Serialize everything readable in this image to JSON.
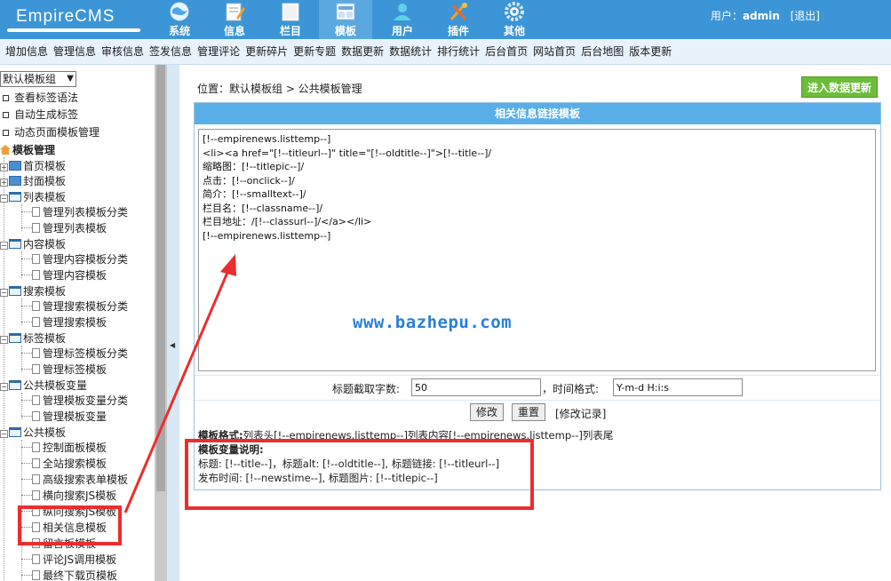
{
  "header": {
    "logo": "EmpireCMS",
    "nav": [
      {
        "label": "系统",
        "icon": "globe-icon"
      },
      {
        "label": "信息",
        "icon": "pencil-note-icon"
      },
      {
        "label": "栏目",
        "icon": "folder-icon"
      },
      {
        "label": "模板",
        "icon": "template-icon"
      },
      {
        "label": "用户",
        "icon": "user-icon"
      },
      {
        "label": "插件",
        "icon": "tools-icon"
      },
      {
        "label": "其他",
        "icon": "gear-icon"
      }
    ],
    "active_nav": "模板",
    "user_prefix": "用户：",
    "user_name": "admin",
    "logout": "[退出]"
  },
  "menubar": [
    "增加信息",
    "管理信息",
    "审核信息",
    "签发信息",
    "管理评论",
    "更新碎片",
    "更新专题",
    "数据更新",
    "数据统计",
    "排行统计",
    "后台首页",
    "网站首页",
    "后台地图",
    "版本更新"
  ],
  "sidebar": {
    "group_select": "默认模板组",
    "top_links": [
      "查看标签语法",
      "自动生成标签",
      "动态页面模板管理"
    ],
    "root": "模板管理",
    "items": {
      "home_tpl": "首页模板",
      "cover_tpl": "封面模板",
      "list_tpl": "列表模板",
      "list_class": "管理列表模板分类",
      "list_manage": "管理列表模板",
      "content_tpl": "内容模板",
      "content_class": "管理内容模板分类",
      "content_manage": "管理内容模板",
      "search_tpl": "搜索模板",
      "search_class": "管理搜索模板分类",
      "search_manage": "管理搜索模板",
      "tag_tpl": "标签模板",
      "tag_class": "管理标签模板分类",
      "tag_manage": "管理标签模板",
      "var_tpl": "公共模板变量",
      "var_class": "管理模板变量分类",
      "var_manage": "管理模板变量",
      "public_tpl": "公共模板",
      "public_list": [
        "控制面板模板",
        "全站搜索模板",
        "高级搜索表单模板",
        "横向搜索JS模板",
        "纵向搜索JS模板",
        "相关信息模板",
        "留言板模板",
        "评论JS调用模板",
        "最终下载页模板"
      ]
    }
  },
  "main": {
    "breadcrumb": "位置：默认模板组  >  公共模板管理",
    "update_button": "进入数据更新",
    "panel_title": "相关信息链接模板",
    "template_text": "[!--empirenews.listtemp--]\n<li><a href=\"[!--titleurl--]\" title=\"[!--oldtitle--]\">[!--title--]/\n缩略图：[!--titlepic--]/\n点击：[!--onclick--]/\n简介：[!--smalltext--]/\n栏目名：[!--classname--]/\n栏目地址：/[!--classurl--]/</a></li>\n[!--empirenews.listtemp--]",
    "watermark": "www.bazhepu.com",
    "title_len_label": "标题截取字数:",
    "title_len_value": "50",
    "time_fmt_label": "，时间格式:",
    "time_fmt_value": "Y-m-d H:i:s",
    "edit_button": "修改",
    "reset_button": "重置",
    "edit_record": "[修改记录]",
    "format_label": "模板格式:",
    "format_text": "列表头[!--empirenews.listtemp--]列表内容[!--empirenews.listtemp--]列表尾",
    "vars_label": "模板变量说明:",
    "vars_line1": "标题: [!--title--]，标题alt: [!--oldtitle--], 标题链接: [!--titleurl--]",
    "vars_line2": "发布时间: [!--newstime--], 标题图片: [!--titlepic--]"
  },
  "colors": {
    "header_bg": "#3b95d6",
    "panel_title_bg": "#5aaee8",
    "update_btn_bg": "#6bbd3a",
    "annotation_red": "#ea2e2e"
  }
}
